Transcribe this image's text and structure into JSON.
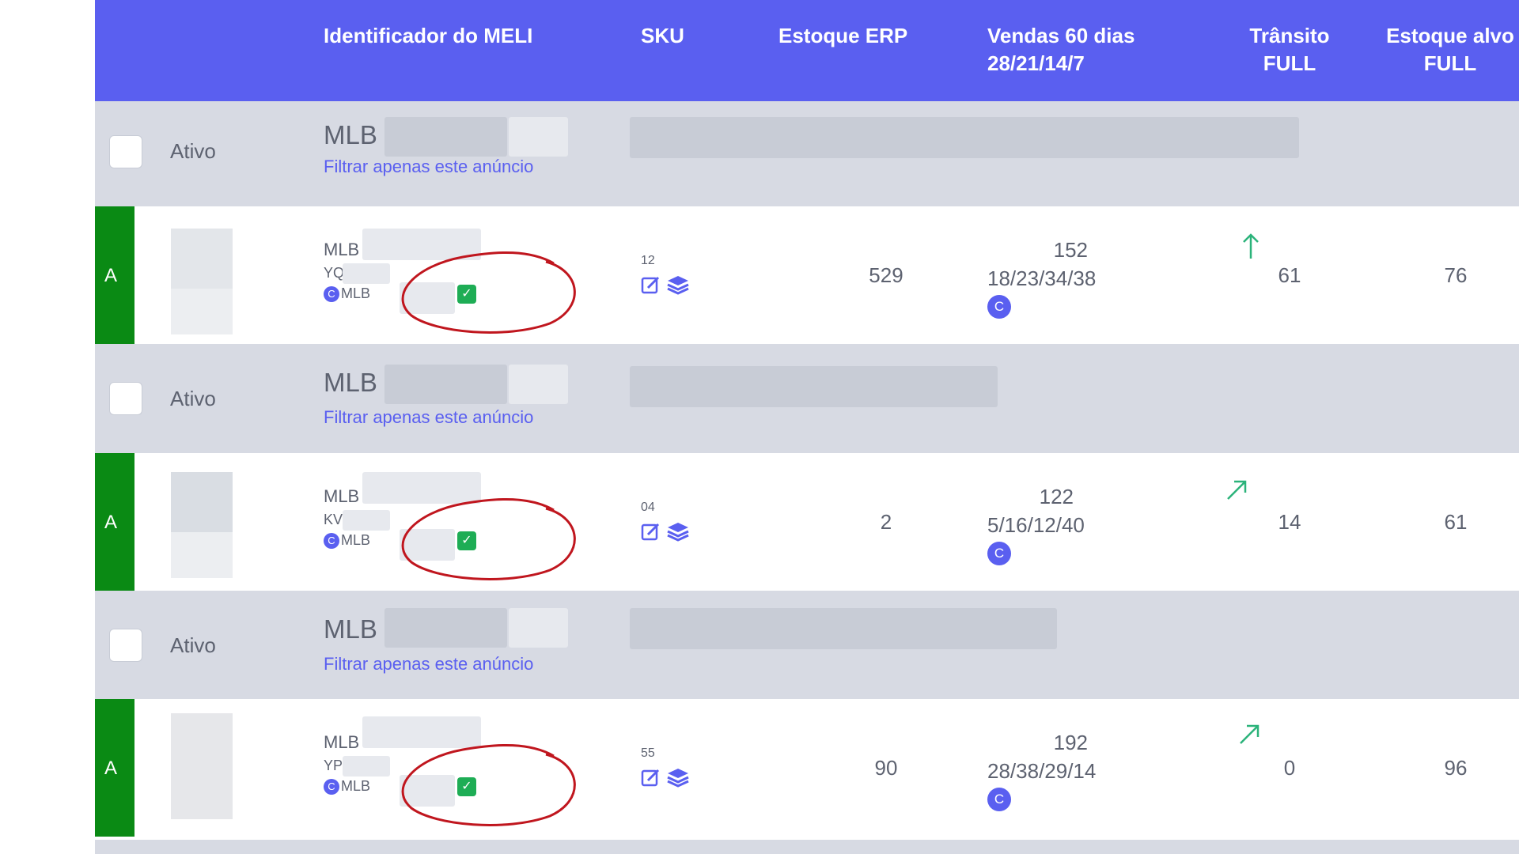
{
  "header": {
    "col_id": "Identificador do MELI",
    "col_sku": "SKU",
    "col_erp": "Estoque ERP",
    "col_vendas_line1": "Vendas 60 dias",
    "col_vendas_line2": "28/21/14/7",
    "col_transito_line1": "Trânsito",
    "col_transito_line2": "FULL",
    "col_alvo_line1": "Estoque alvo",
    "col_alvo_line2": "FULL"
  },
  "groups": [
    {
      "status": "Ativo",
      "mlb_prefix": "MLB",
      "filter_link": "Filtrar apenas este anúncio"
    },
    {
      "status": "Ativo",
      "mlb_prefix": "MLB",
      "filter_link": "Filtrar apenas este anúncio"
    },
    {
      "status": "Ativo",
      "mlb_prefix": "MLB",
      "filter_link": "Filtrar apenas este anúncio"
    }
  ],
  "items": [
    {
      "abc": "A",
      "id_line1": "MLB",
      "id_line2": "YQ",
      "id_line3": "MLB",
      "c_icon": "C",
      "sku_num": "12",
      "estoque_erp": "529",
      "vendas_total": "152",
      "vendas_breakdown": "18/23/34/38",
      "vendas_badge": "C",
      "trend": "up",
      "transito": "61",
      "estoque_alvo": "76"
    },
    {
      "abc": "A",
      "id_line1": "MLB",
      "id_line2": "KV",
      "id_line3": "MLB",
      "c_icon": "C",
      "sku_num": "04",
      "estoque_erp": "2",
      "vendas_total": "122",
      "vendas_breakdown": "5/16/12/40",
      "vendas_badge": "C",
      "trend": "up-right",
      "transito": "14",
      "estoque_alvo": "61"
    },
    {
      "abc": "A",
      "id_line1": "MLB",
      "id_line2": "YP",
      "id_line3": "MLB",
      "c_icon": "C",
      "sku_num": "55",
      "estoque_erp": "90",
      "vendas_total": "192",
      "vendas_breakdown": "28/38/29/14",
      "vendas_badge": "C",
      "trend": "up-right",
      "transito": "0",
      "estoque_alvo": "96"
    }
  ],
  "icons": {
    "edit": "edit-icon",
    "layers": "layers-icon",
    "check": "check-icon",
    "trend_up": "arrow-up-icon",
    "trend_up_right": "arrow-up-right-icon"
  },
  "colors": {
    "header_bg": "#5a5ff0",
    "group_bg": "#d7dae3",
    "abc_green": "#0a8a14",
    "verify_green": "#1ead55",
    "trend_green": "#2bb37a",
    "annotation_red": "#c0161e"
  }
}
